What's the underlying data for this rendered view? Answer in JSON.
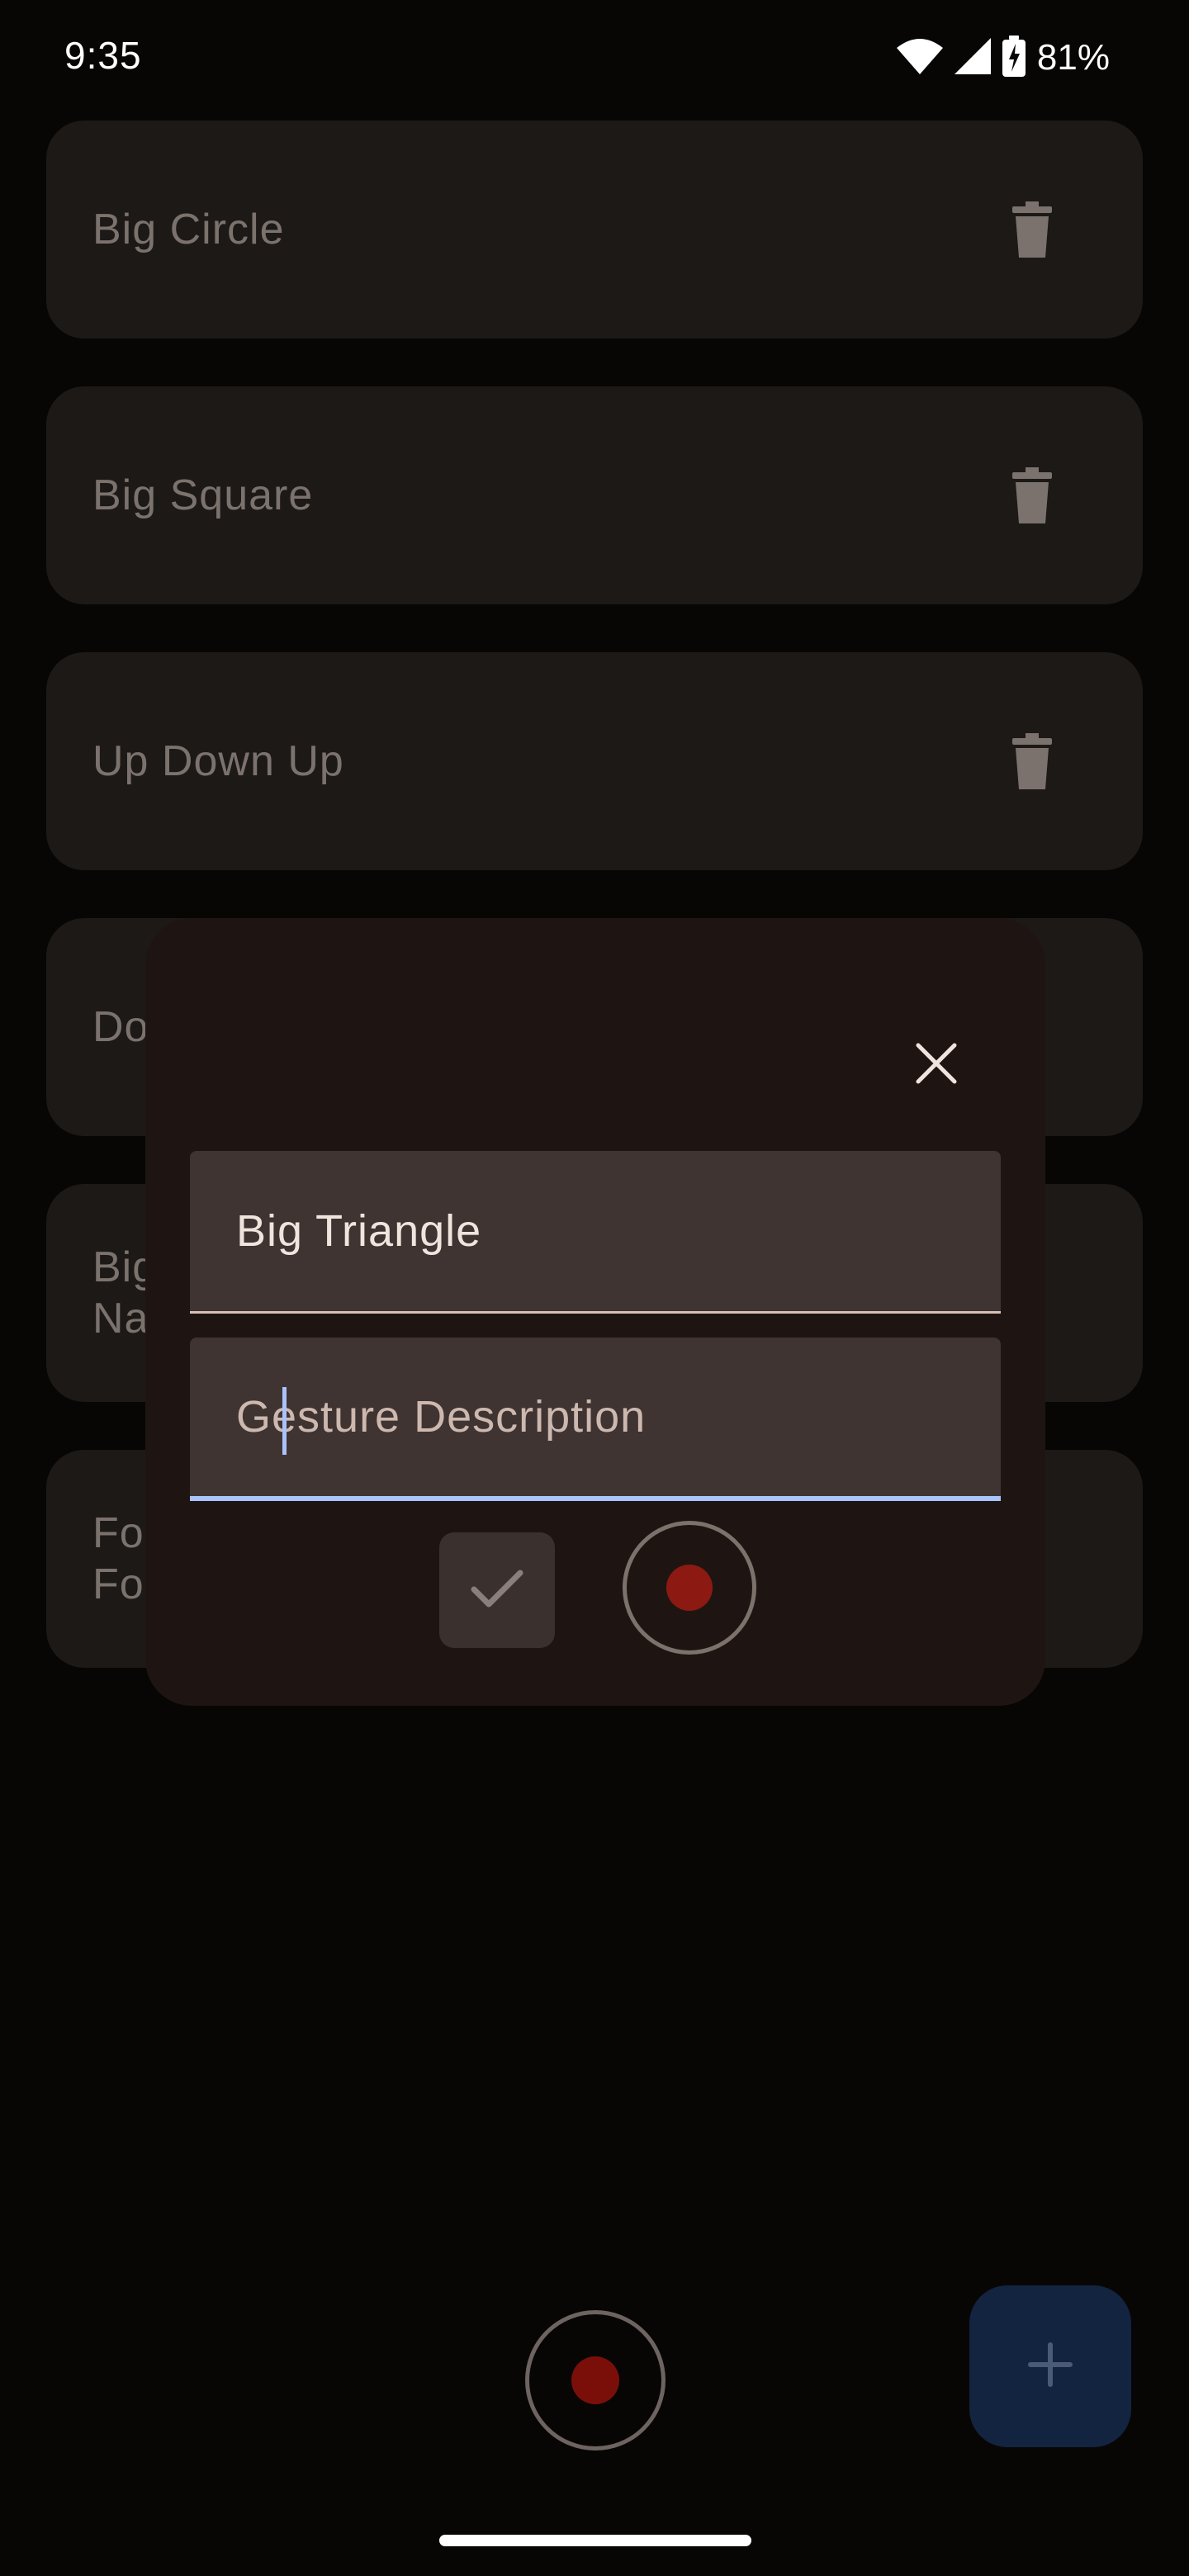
{
  "status_bar": {
    "time": "9:35",
    "battery_text": "81%"
  },
  "gestures": [
    {
      "label": "Big Circle"
    },
    {
      "label": "Big Square"
    },
    {
      "label": "Up Down Up"
    },
    {
      "label": "Do"
    },
    {
      "label": "Big\nNa"
    },
    {
      "label": "Fo\nFo"
    }
  ],
  "dialog": {
    "name_value": "Big Triangle",
    "description_placeholder": "Gesture Description"
  },
  "colors": {
    "accent": "#a9c3ff",
    "record": "#8c1a12",
    "fab": "#132440"
  },
  "icons": {
    "trash": "trash-icon",
    "close": "close-icon",
    "check": "check-icon",
    "add": "plus-icon"
  }
}
